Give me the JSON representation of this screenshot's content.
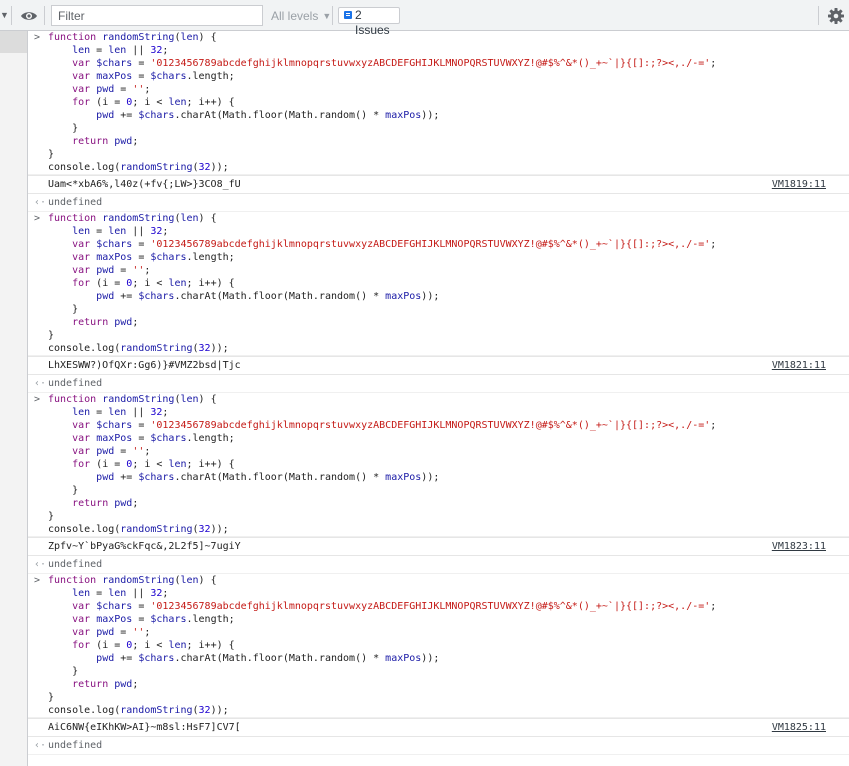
{
  "toolbar": {
    "filter_placeholder": "Filter",
    "levels_label": "All levels",
    "issues_label": "2 Issues",
    "icons": [
      "sidebar-toggle-caret-icon",
      "eye-icon",
      "issues-icon",
      "gear-icon"
    ]
  },
  "code_lines": [
    "function randomString(len) {",
    "    len = len || 32;",
    "    var $chars = '0123456789abcdefghijklmnopqrstuvwxyzABCDEFGHIJKLMNOPQRSTUVWXYZ!@#$%^&*()_+~`|}{[]:;?><,./-=';",
    "    var maxPos = $chars.length;",
    "    var pwd = '';",
    "    for (i = 0; i < len; i++) {",
    "        pwd += $chars.charAt(Math.floor(Math.random() * maxPos));",
    "    }",
    "    return pwd;",
    "}",
    "console.log(randomString(32));"
  ],
  "entries": [
    {
      "output": "Uam<*xbA6%,l40z(+fv{;LW>}3CO8_fU",
      "source": "VM1819:11",
      "return_value": "undefined"
    },
    {
      "output": "LhXESWW?)OfQXr:Gg6)}#VMZ2bsd|Tjc",
      "source": "VM1821:11",
      "return_value": "undefined"
    },
    {
      "output": "Zpfv~Y`bPyaG%ckFqc&,2L2f5]~7ugiY",
      "source": "VM1823:11",
      "return_value": "undefined"
    },
    {
      "output": "AiC6NW{eIKhKW>AI}~m8sl:HsF7]CV7[",
      "source": "VM1825:11",
      "return_value": "undefined"
    }
  ],
  "colors": {
    "keyword": "#881280",
    "identifier": "#1a1aa6",
    "number": "#1c00cf",
    "string": "#c41a16",
    "toolbar_bg": "#f1f3f4",
    "issues_blue": "#1a73e8"
  }
}
